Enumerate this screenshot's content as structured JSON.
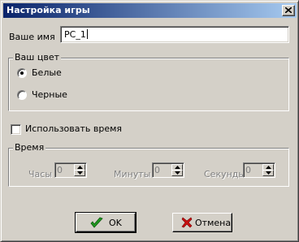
{
  "window": {
    "title": "Настройка игры"
  },
  "name": {
    "label": "Ваше имя",
    "value": "PC_1"
  },
  "color_group": {
    "title": "Ваш цвет",
    "options": [
      {
        "label": "Белые",
        "selected": true
      },
      {
        "label": "Черные",
        "selected": false
      }
    ]
  },
  "use_time": {
    "label": "Использовать время",
    "checked": false
  },
  "time_group": {
    "title": "Время",
    "hours_label": "Часы",
    "hours_value": "0",
    "minutes_label": "Минуты",
    "minutes_value": "0",
    "seconds_label": "Секунды",
    "seconds_value": "0"
  },
  "buttons": {
    "ok_label": "OK",
    "cancel_label": "Отмена"
  },
  "icons": {
    "close": "close-icon",
    "ok": "green-checkmark-icon",
    "cancel": "red-x-icon"
  },
  "colors": {
    "titlebar_start": "#0a246a",
    "titlebar_end": "#a6caf0",
    "face": "#d4d0c8",
    "ok_icon": "#1f9a1f",
    "cancel_icon": "#c81010"
  }
}
